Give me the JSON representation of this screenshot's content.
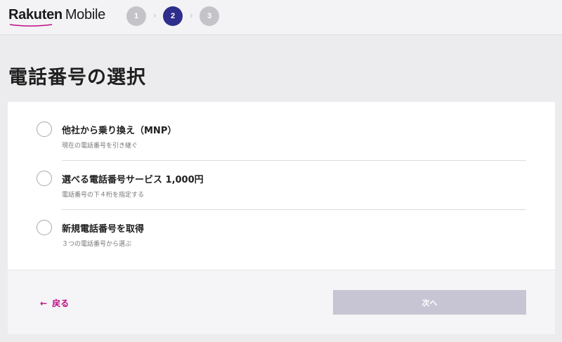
{
  "header": {
    "logo_brand": "Rakuten",
    "logo_product": "Mobile",
    "steps": [
      "1",
      "2",
      "3"
    ],
    "active_step": 2
  },
  "page_title": "電話番号の選択",
  "options": [
    {
      "label": "他社から乗り換え（MNP）",
      "sub": "現在の電話番号を引き継ぐ",
      "selected": false
    },
    {
      "label": "選べる電話番号サービス 1,000円",
      "sub": "電話番号の下４桁を指定する",
      "selected": false
    },
    {
      "label": "新規電話番号を取得",
      "sub": "３つの電話番号から選ぶ",
      "selected": false
    }
  ],
  "footer": {
    "back_label": "戻る",
    "next_label": "次へ"
  },
  "colors": {
    "brand_magenta": "#bf0b86",
    "active_step": "#2e2e8c",
    "inactive_step": "#c4c4c8",
    "disabled_button": "#c7c5d4"
  }
}
